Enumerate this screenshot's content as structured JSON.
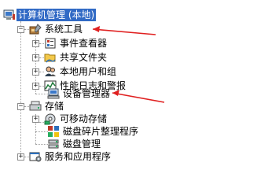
{
  "tree": {
    "root": {
      "label": "计算机管理 (本地)",
      "icon": "computer-management-icon",
      "selected": true
    },
    "items": [
      {
        "label": "系统工具",
        "icon": "system-tools-icon",
        "expanded": true
      },
      {
        "label": "事件查看器",
        "icon": "event-viewer-icon"
      },
      {
        "label": "共享文件夹",
        "icon": "shared-folder-icon"
      },
      {
        "label": "本地用户和组",
        "icon": "users-groups-icon"
      },
      {
        "label": "性能日志和警报",
        "icon": "performance-logs-icon"
      },
      {
        "label": "设备管理器",
        "icon": "device-manager-icon"
      },
      {
        "label": "存储",
        "icon": "storage-icon",
        "expanded": true
      },
      {
        "label": "可移动存储",
        "icon": "removable-storage-icon"
      },
      {
        "label": "磁盘碎片整理程序",
        "icon": "defrag-icon"
      },
      {
        "label": "磁盘管理",
        "icon": "disk-management-icon"
      },
      {
        "label": "服务和应用程序",
        "icon": "services-apps-icon"
      }
    ]
  },
  "colors": {
    "selection": "#316ac5",
    "annotation_arrow": "#e02020"
  }
}
